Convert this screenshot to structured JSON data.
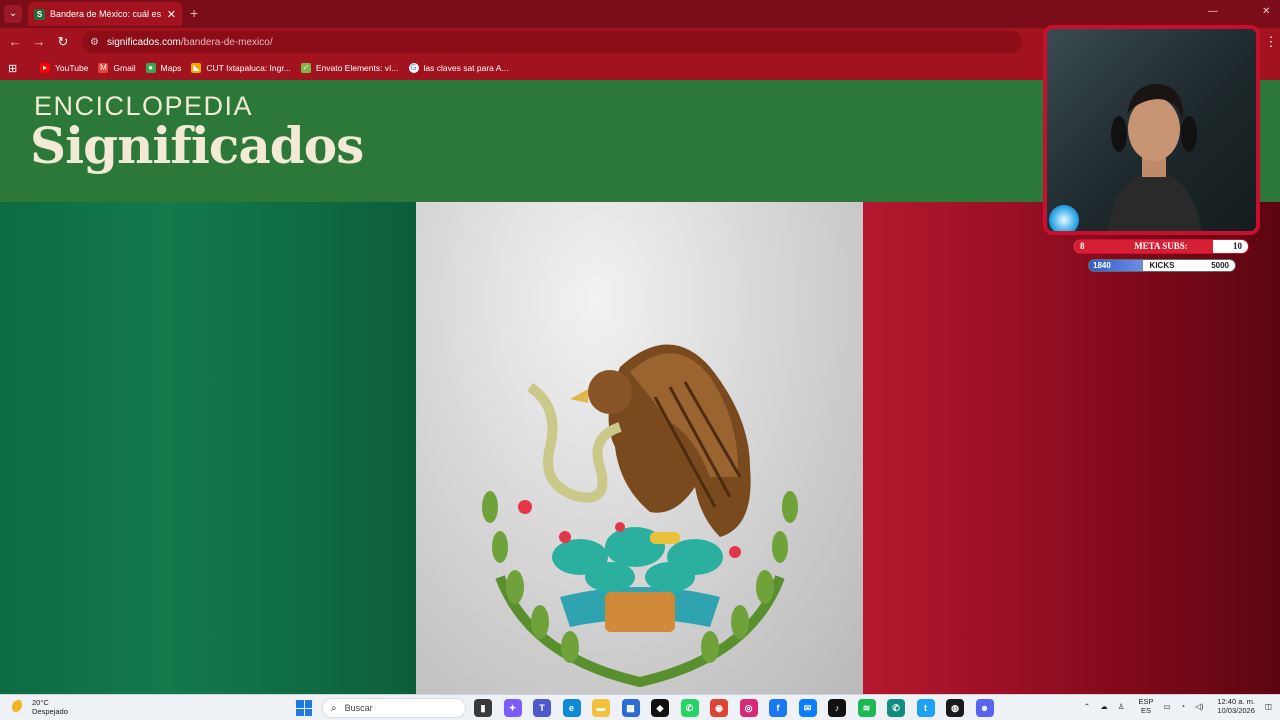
{
  "browser": {
    "tab_title": "Bandera de México: cuál es su s",
    "tab_favicon": "S",
    "url_host": "significados.com",
    "url_path": "/bandera-de-mexico/",
    "bookmarks": [
      {
        "label": "YouTube",
        "icon": "youtube-icon",
        "color": "#ff0000"
      },
      {
        "label": "Gmail",
        "icon": "gmail-icon",
        "color": "#ea4335"
      },
      {
        "label": "Maps",
        "icon": "maps-icon",
        "color": "#34a853"
      },
      {
        "label": "CUT Ixtapaluca: Ingr...",
        "icon": "cut-icon",
        "color": "#f2a900"
      },
      {
        "label": "Envato Elements: ví...",
        "icon": "envato-icon",
        "color": "#82b541"
      },
      {
        "label": "las claves sat para A...",
        "icon": "google-icon",
        "color": "#4285f4"
      }
    ]
  },
  "site": {
    "logo_top": "ENCICLOPEDIA",
    "logo_main": "Significados",
    "header_color": "#2b7838"
  },
  "overlay": {
    "meta_label": "META SUBS:",
    "meta_current": "8",
    "meta_goal": "10",
    "meta_progress": 0.8,
    "kicks_label": "KICKS",
    "kicks_current": "1840",
    "kicks_goal": "5000",
    "kicks_progress": 0.368
  },
  "taskbar": {
    "weather_temp": "20°C",
    "weather_desc": "Despejado",
    "search_placeholder": "Buscar",
    "lang_top": "ESP",
    "lang_bottom": "ES",
    "time": "12:40 a. m.",
    "date": "10/03/2026",
    "apps": [
      {
        "icon": "file-explorer-icon",
        "color": "#3a3a3a",
        "glyph": "▮"
      },
      {
        "icon": "copilot-icon",
        "color": "#7d5cff",
        "glyph": "✦"
      },
      {
        "icon": "teams-icon",
        "color": "#5059c9",
        "glyph": "T"
      },
      {
        "icon": "edge-icon",
        "color": "#0c8ad6",
        "glyph": "e"
      },
      {
        "icon": "folder-icon",
        "color": "#f3c13a",
        "glyph": "▬"
      },
      {
        "icon": "store-icon",
        "color": "#2c6bd1",
        "glyph": "▦"
      },
      {
        "icon": "capcut-icon",
        "color": "#111111",
        "glyph": "◆"
      },
      {
        "icon": "whatsapp-icon",
        "color": "#25d366",
        "glyph": "✆"
      },
      {
        "icon": "chrome-icon",
        "color": "#db4437",
        "glyph": "◉"
      },
      {
        "icon": "instagram-icon",
        "color": "#d62976",
        "glyph": "◎"
      },
      {
        "icon": "facebook-icon",
        "color": "#1877f2",
        "glyph": "f"
      },
      {
        "icon": "messenger-icon",
        "color": "#0a7cff",
        "glyph": "✉"
      },
      {
        "icon": "tiktok-icon",
        "color": "#111111",
        "glyph": "♪"
      },
      {
        "icon": "spotify-icon",
        "color": "#1db954",
        "glyph": "≋"
      },
      {
        "icon": "whatsapp-business-icon",
        "color": "#128c7e",
        "glyph": "✆"
      },
      {
        "icon": "twitter-icon",
        "color": "#1da1f2",
        "glyph": "t"
      },
      {
        "icon": "obs-icon",
        "color": "#1a1a1a",
        "glyph": "◍"
      },
      {
        "icon": "discord-icon",
        "color": "#5865f2",
        "glyph": "☻"
      }
    ]
  }
}
